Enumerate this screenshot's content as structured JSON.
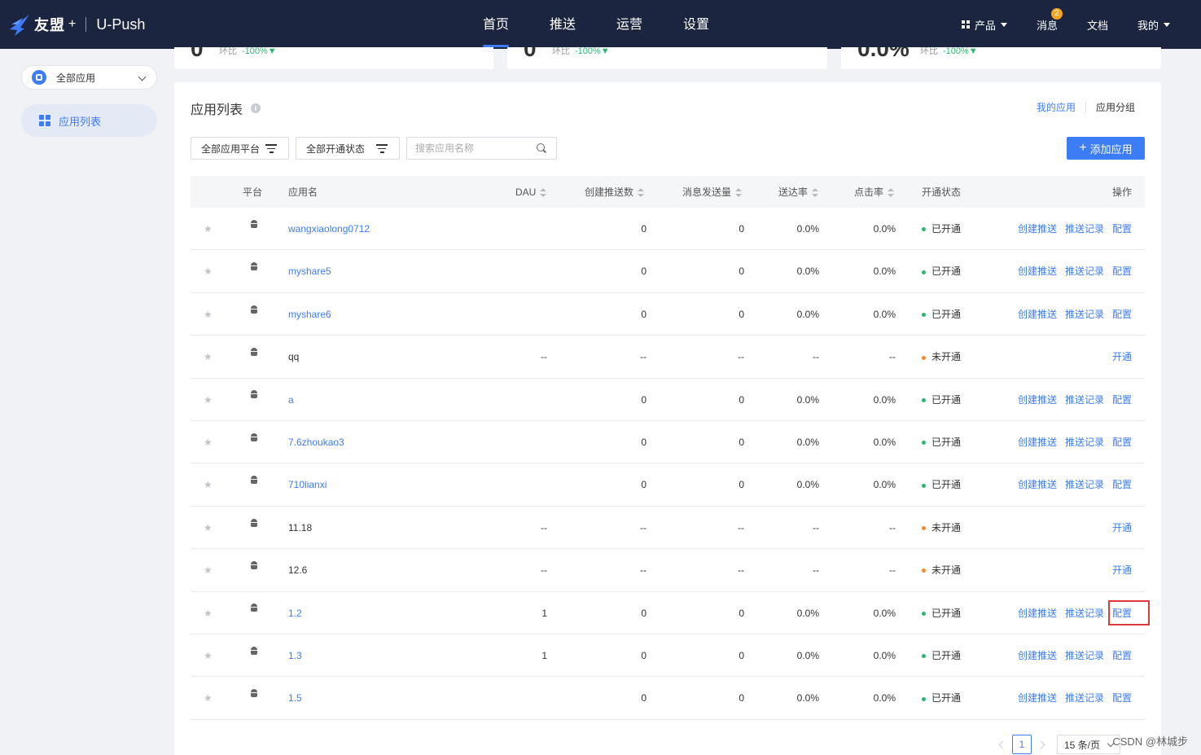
{
  "header": {
    "brand": "友盟",
    "brand_plus": "+",
    "product": "U-Push",
    "nav": [
      {
        "label": "首页",
        "active": true
      },
      {
        "label": "推送",
        "active": false
      },
      {
        "label": "运营",
        "active": false
      },
      {
        "label": "设置",
        "active": false
      }
    ],
    "right": {
      "products": "产品",
      "messages": "消息",
      "messages_badge": "2",
      "docs": "文档",
      "mine": "我的"
    }
  },
  "sidebar": {
    "app_select": "全部应用",
    "items": [
      {
        "label": "应用列表",
        "icon": "grid-icon"
      }
    ]
  },
  "stats": [
    {
      "value": "0",
      "label": "环比",
      "change": "-100%▼"
    },
    {
      "value": "0",
      "label": "环比",
      "change": "-100%▼"
    },
    {
      "value": "0.0%",
      "label": "环比",
      "change": "-100%▼"
    }
  ],
  "card": {
    "title": "应用列表",
    "links": {
      "my_apps": "我的应用",
      "app_groups": "应用分组"
    },
    "filters": {
      "platform": "全部应用平台",
      "status": "全部开通状态"
    },
    "search": {
      "placeholder": "搜索应用名称",
      "value": ""
    },
    "add_button": "添加应用"
  },
  "table": {
    "columns": {
      "platform": "平台",
      "name": "应用名",
      "dau": "DAU",
      "created": "创建推送数",
      "sent": "消息发送量",
      "delivery": "送达率",
      "click": "点击率",
      "status": "开通状态",
      "ops": "操作"
    },
    "ops_labels": {
      "create": "创建推送",
      "history": "推送记录",
      "config": "配置",
      "activate": "开通"
    },
    "rows": [
      {
        "name": "wangxiaolong0712",
        "linked": true,
        "dau": "",
        "created": "0",
        "sent": "0",
        "delivery": "0.0%",
        "click": "0.0%",
        "status": "已开通",
        "opened": true
      },
      {
        "name": "myshare5",
        "linked": true,
        "dau": "",
        "created": "0",
        "sent": "0",
        "delivery": "0.0%",
        "click": "0.0%",
        "status": "已开通",
        "opened": true
      },
      {
        "name": "myshare6",
        "linked": true,
        "dau": "",
        "created": "0",
        "sent": "0",
        "delivery": "0.0%",
        "click": "0.0%",
        "status": "已开通",
        "opened": true
      },
      {
        "name": "qq",
        "linked": false,
        "dau": "--",
        "created": "--",
        "sent": "--",
        "delivery": "--",
        "click": "--",
        "status": "未开通",
        "opened": false
      },
      {
        "name": "a",
        "linked": true,
        "dau": "",
        "created": "0",
        "sent": "0",
        "delivery": "0.0%",
        "click": "0.0%",
        "status": "已开通",
        "opened": true
      },
      {
        "name": "7.6zhoukao3",
        "linked": true,
        "dau": "",
        "created": "0",
        "sent": "0",
        "delivery": "0.0%",
        "click": "0.0%",
        "status": "已开通",
        "opened": true
      },
      {
        "name": "710lianxi",
        "linked": true,
        "dau": "",
        "created": "0",
        "sent": "0",
        "delivery": "0.0%",
        "click": "0.0%",
        "status": "已开通",
        "opened": true
      },
      {
        "name": "11.18",
        "linked": false,
        "dau": "--",
        "created": "--",
        "sent": "--",
        "delivery": "--",
        "click": "--",
        "status": "未开通",
        "opened": false
      },
      {
        "name": "12.6",
        "linked": false,
        "dau": "--",
        "created": "--",
        "sent": "--",
        "delivery": "--",
        "click": "--",
        "status": "未开通",
        "opened": false
      },
      {
        "name": "1.2",
        "linked": true,
        "dau": "1",
        "created": "0",
        "sent": "0",
        "delivery": "0.0%",
        "click": "0.0%",
        "status": "已开通",
        "opened": true
      },
      {
        "name": "1.3",
        "linked": true,
        "dau": "1",
        "created": "0",
        "sent": "0",
        "delivery": "0.0%",
        "click": "0.0%",
        "status": "已开通",
        "opened": true
      },
      {
        "name": "1.5",
        "linked": true,
        "dau": "",
        "created": "0",
        "sent": "0",
        "delivery": "0.0%",
        "click": "0.0%",
        "status": "已开通",
        "opened": true
      }
    ],
    "highlighted_row": 9
  },
  "pagination": {
    "current": "1",
    "page_size": "15 条/页"
  },
  "colors": {
    "accent": "#3c7cf5",
    "open": "#2bb673",
    "closed": "#f5892b",
    "highlight": "#e03b3b",
    "header_bg": "#1b2540"
  },
  "watermark": "CSDN @林城步"
}
